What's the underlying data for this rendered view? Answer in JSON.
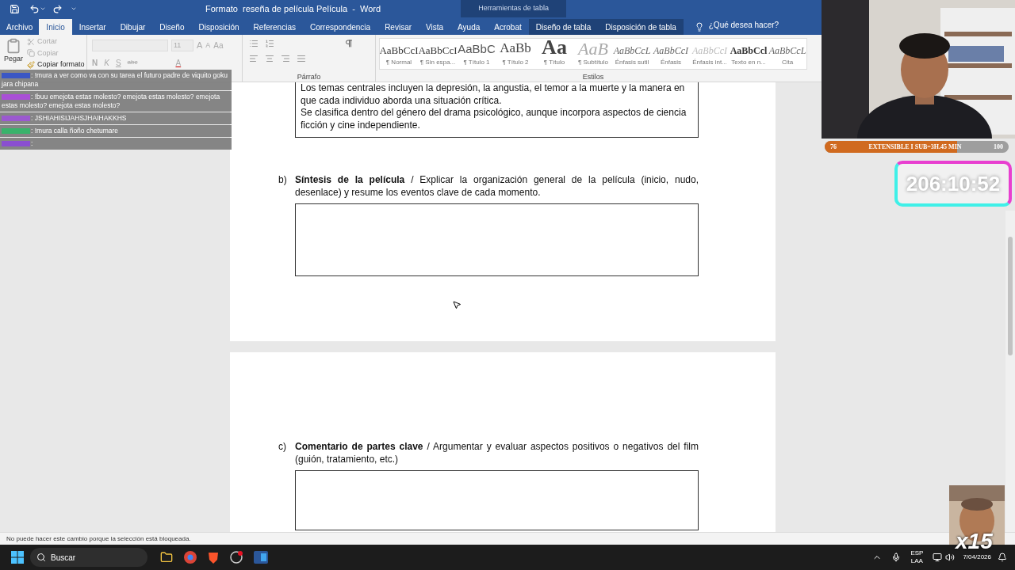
{
  "window": {
    "title": "Formato  reseña de película Película  -  Word",
    "contextual_title": "Herramientas de tabla"
  },
  "menu_tabs": [
    {
      "label": "Archivo",
      "selected": false,
      "kind": "file"
    },
    {
      "label": "Inicio",
      "selected": true,
      "kind": "tab"
    },
    {
      "label": "Insertar",
      "selected": false,
      "kind": "tab"
    },
    {
      "label": "Dibujar",
      "selected": false,
      "kind": "tab"
    },
    {
      "label": "Diseño",
      "selected": false,
      "kind": "tab"
    },
    {
      "label": "Disposición",
      "selected": false,
      "kind": "tab"
    },
    {
      "label": "Referencias",
      "selected": false,
      "kind": "tab"
    },
    {
      "label": "Correspondencia",
      "selected": false,
      "kind": "tab"
    },
    {
      "label": "Revisar",
      "selected": false,
      "kind": "tab"
    },
    {
      "label": "Vista",
      "selected": false,
      "kind": "tab"
    },
    {
      "label": "Ayuda",
      "selected": false,
      "kind": "tab"
    },
    {
      "label": "Acrobat",
      "selected": false,
      "kind": "tab"
    },
    {
      "label": "Diseño de tabla",
      "selected": false,
      "kind": "contextual"
    },
    {
      "label": "Disposición de tabla",
      "selected": false,
      "kind": "contextual"
    }
  ],
  "tell_me": "¿Qué desea hacer?",
  "ribbon": {
    "clipboard": {
      "paste": "Pegar",
      "cut": "Cortar",
      "copy": "Copiar",
      "format_painter": "Copiar formato"
    },
    "font": {
      "size": "11",
      "grow": "A",
      "shrink": "A",
      "case": "Aa",
      "bold": "N",
      "italic": "K",
      "underline": "S",
      "strike": "abc",
      "font_color_button": "A"
    },
    "paragraph": {
      "label": "Párrafo"
    },
    "styles": {
      "label": "Estilos",
      "items": [
        {
          "preview": "AaBbCcI",
          "name": "¶ Normal",
          "kind": "plain"
        },
        {
          "preview": "AaBbCcI",
          "name": "¶ Sin espa...",
          "kind": "plain"
        },
        {
          "preview": "AaBbC",
          "name": "¶ Título 1",
          "kind": "heading"
        },
        {
          "preview": "AaBb",
          "name": "¶ Título 2",
          "kind": "heading2"
        },
        {
          "preview": "Aa",
          "name": "¶ Título",
          "kind": "title"
        },
        {
          "preview": "AaB",
          "name": "¶ Subtítulo",
          "kind": "subtitle"
        },
        {
          "preview": "AaBbCcL",
          "name": "Énfasis sutil",
          "kind": "italic"
        },
        {
          "preview": "AaBbCcI",
          "name": "Énfasis",
          "kind": "italic"
        },
        {
          "preview": "AaBbCcI",
          "name": "Énfasis int...",
          "kind": "faint"
        },
        {
          "preview": "AaBbCcl",
          "name": "Texto en n...",
          "kind": "bold"
        },
        {
          "preview": "AaBbCcL",
          "name": "Cita",
          "kind": "italic"
        }
      ]
    }
  },
  "chat": [
    {
      "color": "#3b57c4",
      "message": ": !mura a ver como va con su tarea el futuro padre de viquito goku jara chipana"
    },
    {
      "color": "#a94fd6",
      "message": ": !buu emejota estas molesto? emejota estas molesto? emejota estas molesto? emejota estas molesto?"
    },
    {
      "color": "#9b59d0",
      "message": ": JSHIAHISIJAHSJHAIHAKKHS"
    },
    {
      "color": "#39b36b",
      "message": ": !mura calla ñoño chetumare"
    },
    {
      "color": "#8a4fd0",
      "message": ":"
    }
  ],
  "document": {
    "answer_paragraphs": [
      "Los temas centrales incluyen la depresión, la angustia, el temor a la muerte y la manera en que cada individuo aborda una situación crítica.",
      "Se clasifica dentro del género del drama psicológico, aunque incorpora aspectos de ciencia ficción y cine independiente."
    ],
    "sections": [
      {
        "letter": "b)",
        "title": "Síntesis de la película",
        "instruction": " / Explicar la organización general de la película (inicio, nudo, desenlace) y resume los eventos clave de cada momento."
      },
      {
        "letter": "c)",
        "title": "Comentario de partes clave",
        "instruction": " / Argumentar y evaluar aspectos positivos o negativos del film (guión, tratamiento, etc.)"
      }
    ]
  },
  "status_bar": "No puede hacer este cambio porque la selección está bloqueada.",
  "stream": {
    "goal": {
      "start": "76",
      "label": "EXTENSIBLE I SUB=3H.45 MIN",
      "end": "100",
      "level": 0.72
    },
    "timer": "206:10:52",
    "multiplier": "x15"
  },
  "taskbar": {
    "search": "Buscar",
    "language": "ESP",
    "region": "LAA",
    "date": "7/04/2026"
  }
}
